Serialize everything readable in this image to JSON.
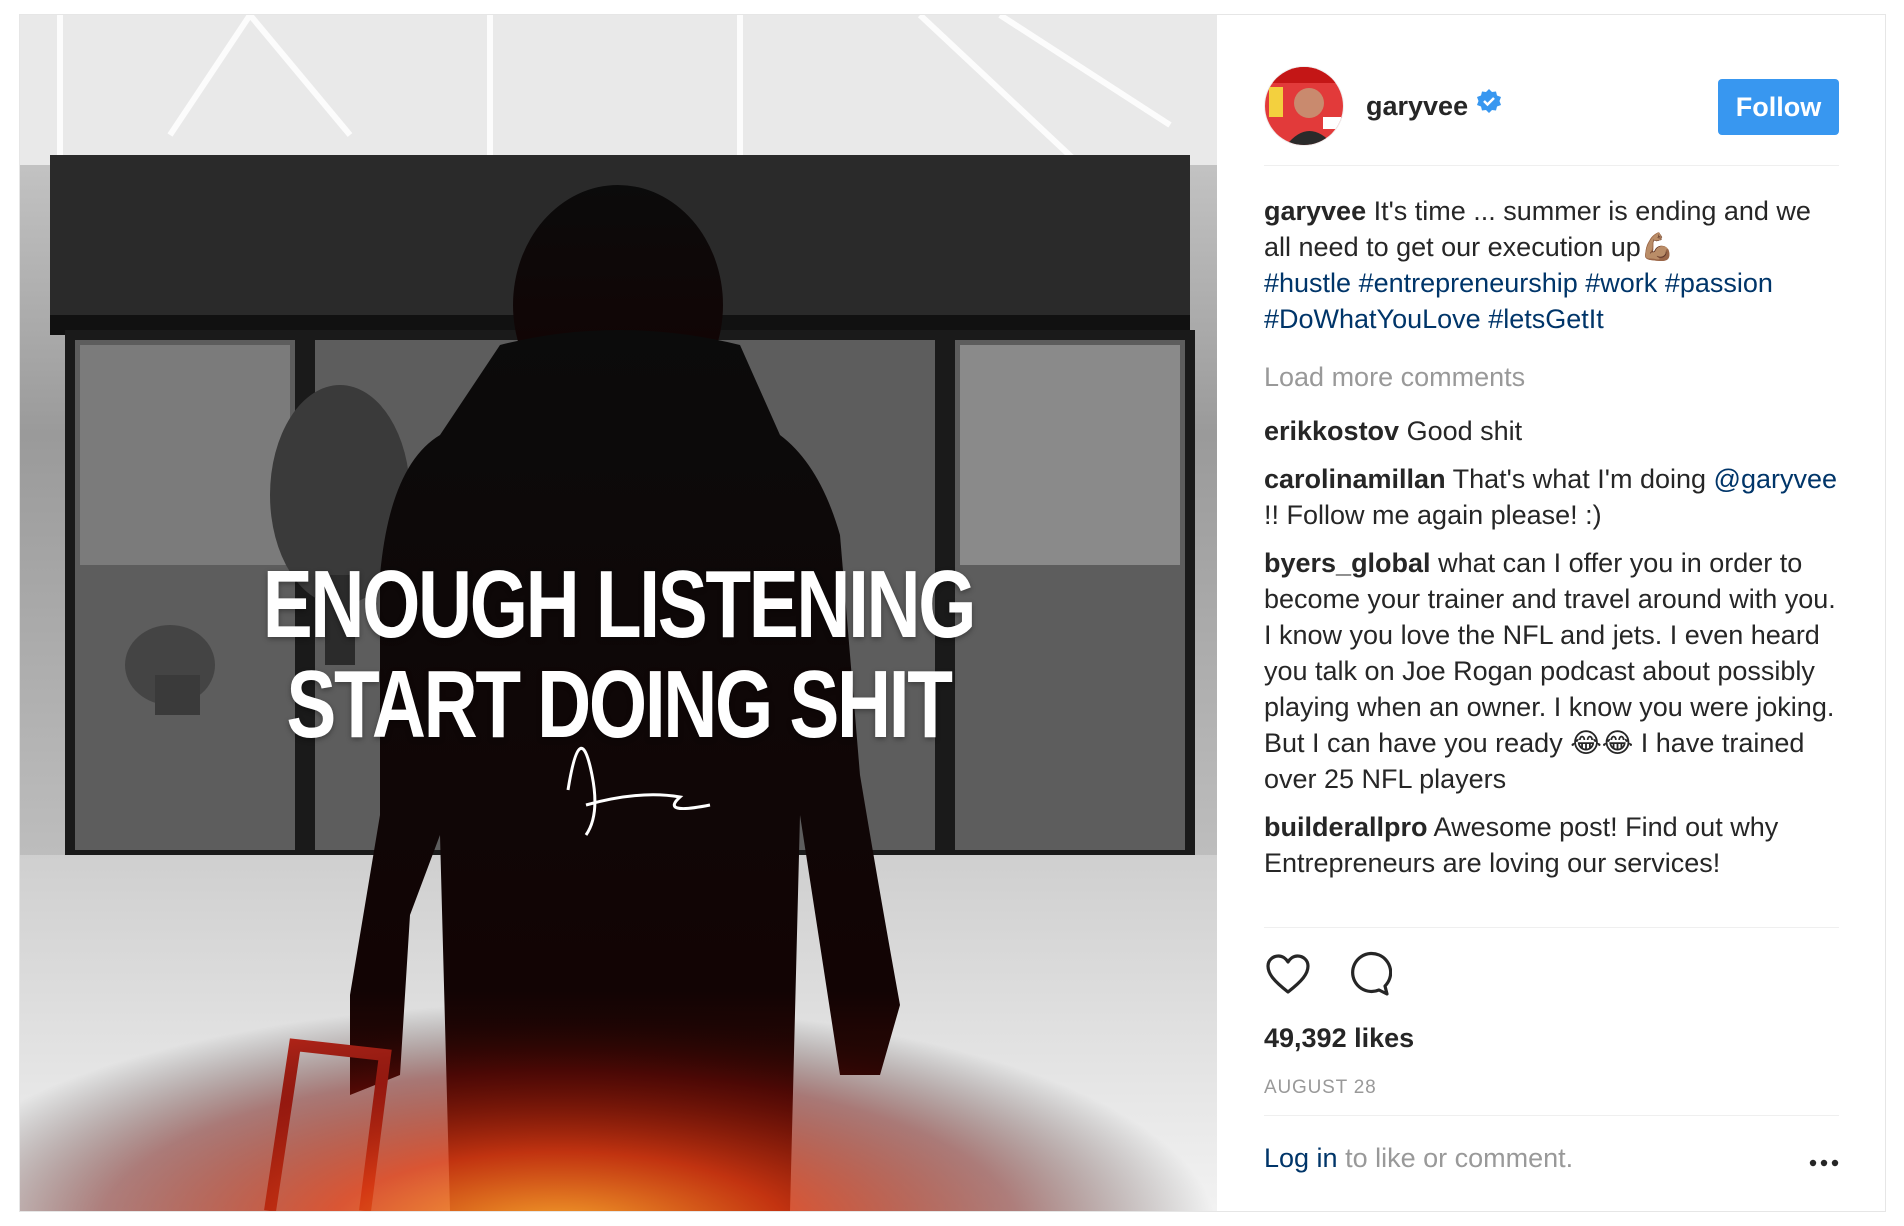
{
  "colors": {
    "accent": "#3897f0",
    "link": "#003569",
    "muted": "#999999",
    "text": "#262626"
  },
  "post_image": {
    "headline_line1": "ENOUGH LISTENING",
    "headline_line2": "START DOING SHIT"
  },
  "header": {
    "username": "garyvee",
    "verified_icon": "verified-badge-icon",
    "follow_label": "Follow"
  },
  "caption": {
    "user": "garyvee",
    "text": "It's time ... summer is ending and we all need to get our execution up💪🏽",
    "hashtags": [
      "#hustle",
      "#entrepreneurship",
      "#work",
      "#passion",
      "#DoWhatYouLove",
      "#letsGetIt"
    ]
  },
  "load_more_label": "Load more comments",
  "comments": [
    {
      "user": "erikkostov",
      "text": "Good shit"
    },
    {
      "user": "carolinamillan",
      "text_before": "That's what I'm doing",
      "mention": "@garyvee",
      "text_after": "!! Follow me again please! :)"
    },
    {
      "user": "byers_global",
      "text": "what can I offer you in order to become your trainer and travel around with you. I know you love the NFL and jets. I even heard you talk on Joe Rogan podcast about possibly playing when an owner. I know you were joking. But I can have you ready 😂😂 I have trained over 25 NFL players"
    },
    {
      "user": "builderallpro",
      "text": "Awesome post! Find out why Entrepreneurs are loving our services!"
    }
  ],
  "actions": {
    "like_icon": "heart-icon",
    "comment_icon": "comment-bubble-icon",
    "more_icon": "more-options-icon"
  },
  "likes_label": "49,392 likes",
  "date_label": "AUGUST 28",
  "login": {
    "link_label": "Log in",
    "rest_label": "to like or comment."
  }
}
